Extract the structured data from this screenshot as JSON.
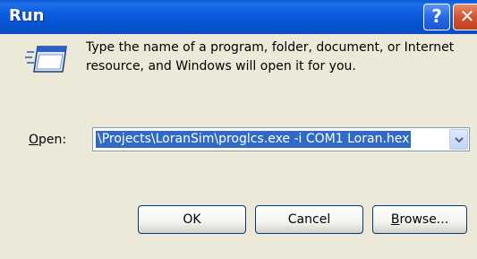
{
  "window": {
    "title": "Run",
    "help_label": "?",
    "close_label": "✕"
  },
  "dialog": {
    "icon": "run-program-icon",
    "description": "Type the name of a program, folder, document, or Internet resource, and Windows will open it for you.",
    "open_label_prefix": "O",
    "open_label_rest": "pen:",
    "command_value": "\\Projects\\LoranSim\\proglcs.exe -i COM1 Loran.hex"
  },
  "buttons": {
    "ok": "OK",
    "cancel": "Cancel",
    "browse_prefix": "B",
    "browse_rest": "rowse..."
  },
  "colors": {
    "titlebar": "#0653d4",
    "dialog_bg": "#ece9d8",
    "selection": "#316ac5",
    "close_red": "#d2542e"
  }
}
